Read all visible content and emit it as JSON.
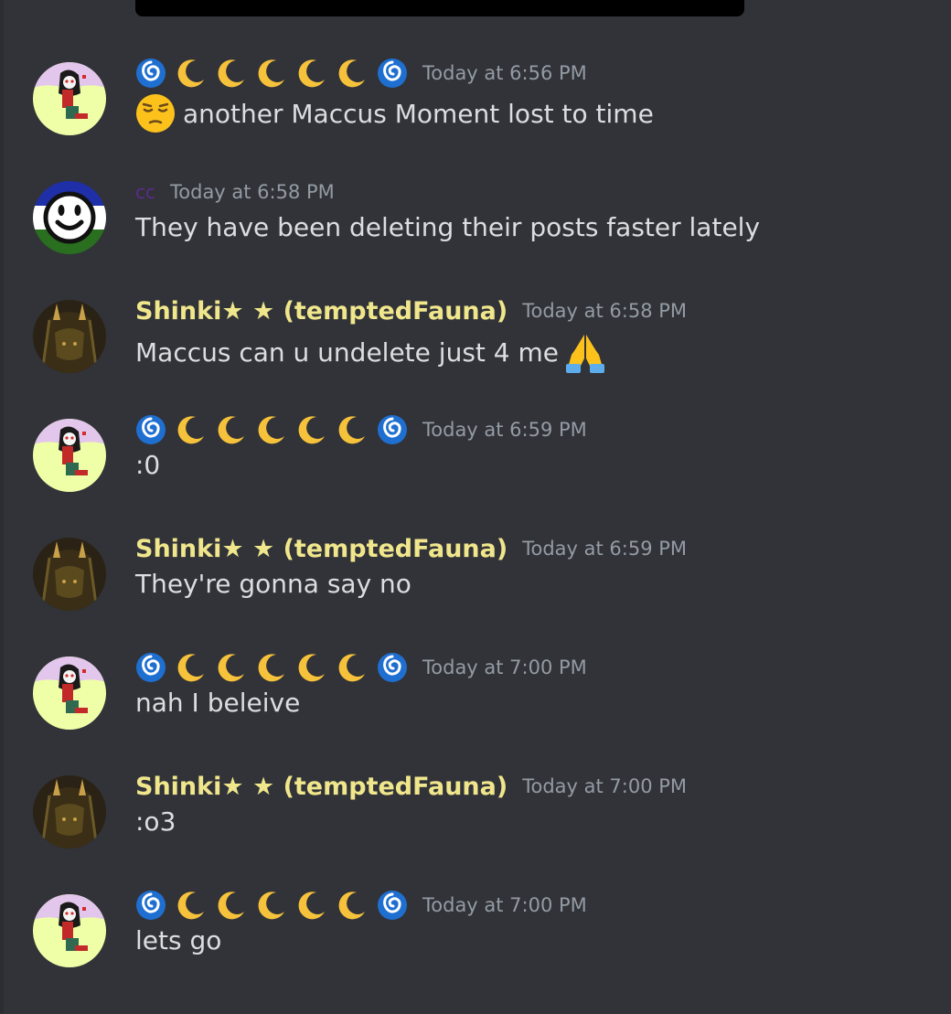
{
  "colors": {
    "background": "#313338",
    "username_gold": "#f0e68c",
    "username_cc": "#5b2c8a",
    "text": "#dbdee1",
    "timestamp": "#949ba4"
  },
  "users": {
    "maccus": {
      "name_icons": [
        "cyclone-icon",
        "crescent-moon-icon",
        "crescent-moon-icon",
        "crescent-moon-icon",
        "crescent-moon-icon",
        "crescent-moon-icon",
        "cyclone-icon"
      ]
    },
    "cc": {
      "name": "cc"
    },
    "shinki": {
      "name": "Shinki★ ★ (temptedFauna)"
    }
  },
  "messages": [
    {
      "user": "maccus",
      "timestamp": "Today at 6:56 PM",
      "text": "another Maccus Moment lost to time",
      "leading_emoji": "pensive-face-icon"
    },
    {
      "user": "cc",
      "timestamp": "Today at 6:58 PM",
      "text": "They have been deleting their posts faster lately"
    },
    {
      "user": "shinki",
      "timestamp": "Today at 6:58 PM",
      "text": "Maccus can u undelete just 4 me",
      "trailing_emoji": "folded-hands-icon"
    },
    {
      "user": "maccus",
      "timestamp": "Today at 6:59 PM",
      "text": ":0"
    },
    {
      "user": "shinki",
      "timestamp": "Today at 6:59 PM",
      "text": "They're gonna say no"
    },
    {
      "user": "maccus",
      "timestamp": "Today at 7:00 PM",
      "text": "nah I beleive"
    },
    {
      "user": "shinki",
      "timestamp": "Today at 7:00 PM",
      "text": ":o3"
    },
    {
      "user": "maccus",
      "timestamp": "Today at 7:00 PM",
      "text": "lets go"
    }
  ]
}
